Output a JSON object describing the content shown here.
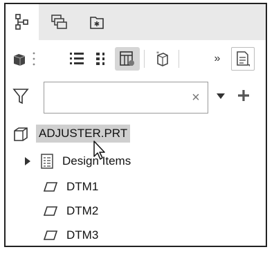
{
  "tabs": [
    {
      "name": "model-tree-tab",
      "icon": "model-tree-icon",
      "active": true
    },
    {
      "name": "layers-tab",
      "icon": "layers-icon",
      "active": false
    },
    {
      "name": "folder-browser-tab",
      "icon": "folder-star-icon",
      "active": false
    }
  ],
  "toolbar": {
    "more_label": "»"
  },
  "filter": {
    "search_value": "",
    "search_placeholder": "",
    "clear_glyph": "×"
  },
  "tree": {
    "root": {
      "label": "ADJUSTER.PRT",
      "icon": "part-icon"
    },
    "items": [
      {
        "label": "Design Items",
        "icon": "design-items-icon",
        "expandable": true
      },
      {
        "label": "DTM1",
        "icon": "datum-plane-icon",
        "expandable": false
      },
      {
        "label": "DTM2",
        "icon": "datum-plane-icon",
        "expandable": false
      },
      {
        "label": "DTM3",
        "icon": "datum-plane-icon",
        "expandable": false
      }
    ]
  },
  "colors": {
    "tab_bar": "#e9e9e9",
    "selection": "#cfcfcf",
    "pressed": "#d6d6d6",
    "border": "#222222"
  }
}
